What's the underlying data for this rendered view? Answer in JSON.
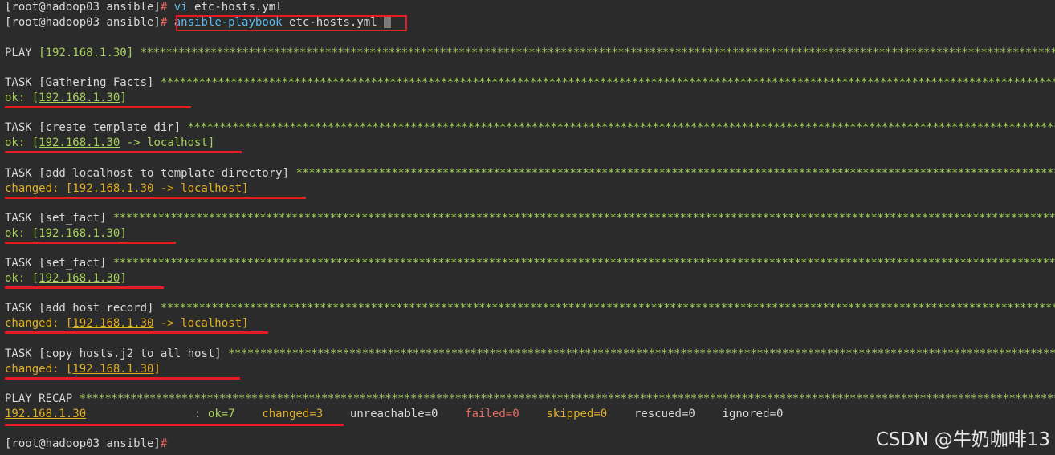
{
  "prompt": {
    "user_host": "[root@hadoop03 ansible]",
    "hash": "#"
  },
  "commands": [
    {
      "cmd": "vi",
      "arg": "etc-hosts.yml"
    },
    {
      "cmd": "ansible-playbook",
      "arg": "etc-hosts.yml"
    }
  ],
  "stars_short": "**************************************************************************************************************************************************************************************************",
  "play": {
    "label": "PLAY",
    "host": "[192.168.1.30]"
  },
  "tasks": [
    {
      "title": "TASK [Gathering Facts]",
      "status": "ok:",
      "host": "192.168.1.30",
      "suffix": "]"
    },
    {
      "title": "TASK [create template dir]",
      "status": "ok:",
      "host": "192.168.1.30",
      "suffix": " -> localhost]"
    },
    {
      "title": "TASK [add localhost to template directory]",
      "status": "changed:",
      "host": "192.168.1.30",
      "suffix": " -> localhost]"
    },
    {
      "title": "TASK [set_fact]",
      "status": "ok:",
      "host": "192.168.1.30",
      "suffix": "]"
    },
    {
      "title": "TASK [set_fact]",
      "status": "ok:",
      "host": "192.168.1.30",
      "suffix": "]"
    },
    {
      "title": "TASK [add host record]",
      "status": "changed:",
      "host": "192.168.1.30",
      "suffix": " -> localhost]"
    },
    {
      "title": "TASK [copy hosts.j2 to all host]",
      "status": "changed:",
      "host": "192.168.1.30",
      "suffix": "]"
    }
  ],
  "recap": {
    "title": "PLAY RECAP",
    "host": "192.168.1.30",
    "sep": ":",
    "ok": "ok=7",
    "changed": "changed=3",
    "unreachable": "unreachable=0",
    "failed": "failed=0",
    "skipped": "skipped=0",
    "rescued": "rescued=0",
    "ignored": "ignored=0"
  },
  "watermark": "CSDN @牛奶咖啡13",
  "colors": {
    "highlight": "#e51c23",
    "ok": "#a6d05a",
    "changed": "#e0b020",
    "command": "#5fb8e8"
  }
}
